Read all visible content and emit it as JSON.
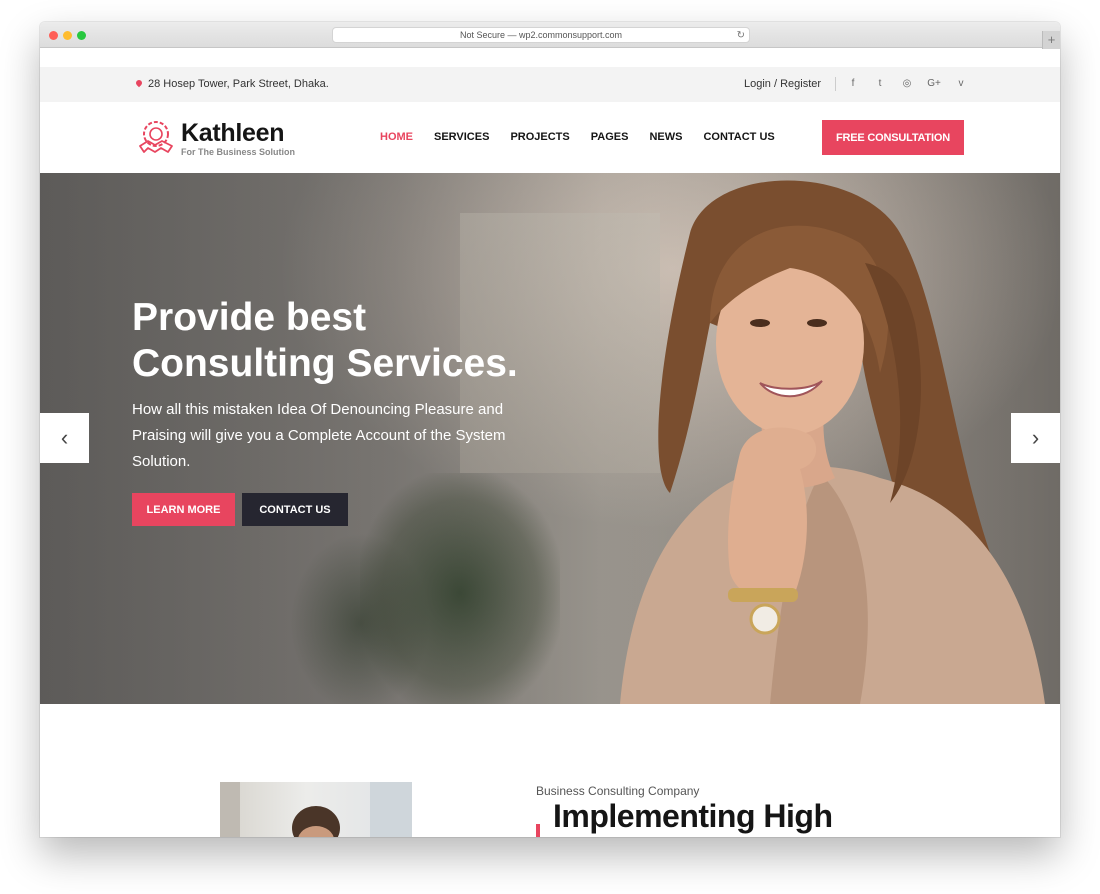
{
  "browser": {
    "url": "Not Secure — wp2.commonsupport.com",
    "reload_icon": "reload-icon",
    "new_tab": "+"
  },
  "topbar": {
    "address": "28 Hosep Tower, Park Street, Dhaka.",
    "login": "Login / Register",
    "socials": [
      {
        "icon": "facebook-icon",
        "glyph": "f"
      },
      {
        "icon": "twitter-icon",
        "glyph": "t"
      },
      {
        "icon": "dribbble-icon",
        "glyph": "◎"
      },
      {
        "icon": "google-plus-icon",
        "glyph": "G+"
      },
      {
        "icon": "vimeo-icon",
        "glyph": "v"
      }
    ]
  },
  "header": {
    "logo_name": "Kathleen",
    "logo_tagline": "For The Business Solution",
    "nav": [
      {
        "label": "HOME",
        "active": true
      },
      {
        "label": "SERVICES",
        "active": false
      },
      {
        "label": "PROJECTS",
        "active": false
      },
      {
        "label": "PAGES",
        "active": false
      },
      {
        "label": "NEWS",
        "active": false
      },
      {
        "label": "CONTACT US",
        "active": false
      }
    ],
    "cta": "FREE CONSULTATION"
  },
  "hero": {
    "title_line1": "Provide best",
    "title_line2": "Consulting Services.",
    "description": "How all this mistaken Idea Of Denouncing Pleasure and Praising will give you a Complete Account of the System Solution.",
    "learn_more": "LEARN MORE",
    "contact_us": "CONTACT US",
    "prev_icon": "‹",
    "next_icon": "›"
  },
  "about": {
    "kicker": "Business Consulting Company",
    "title": "Implementing High"
  },
  "colors": {
    "accent": "#e8455f",
    "dark_button": "#262630",
    "text": "#151515"
  }
}
